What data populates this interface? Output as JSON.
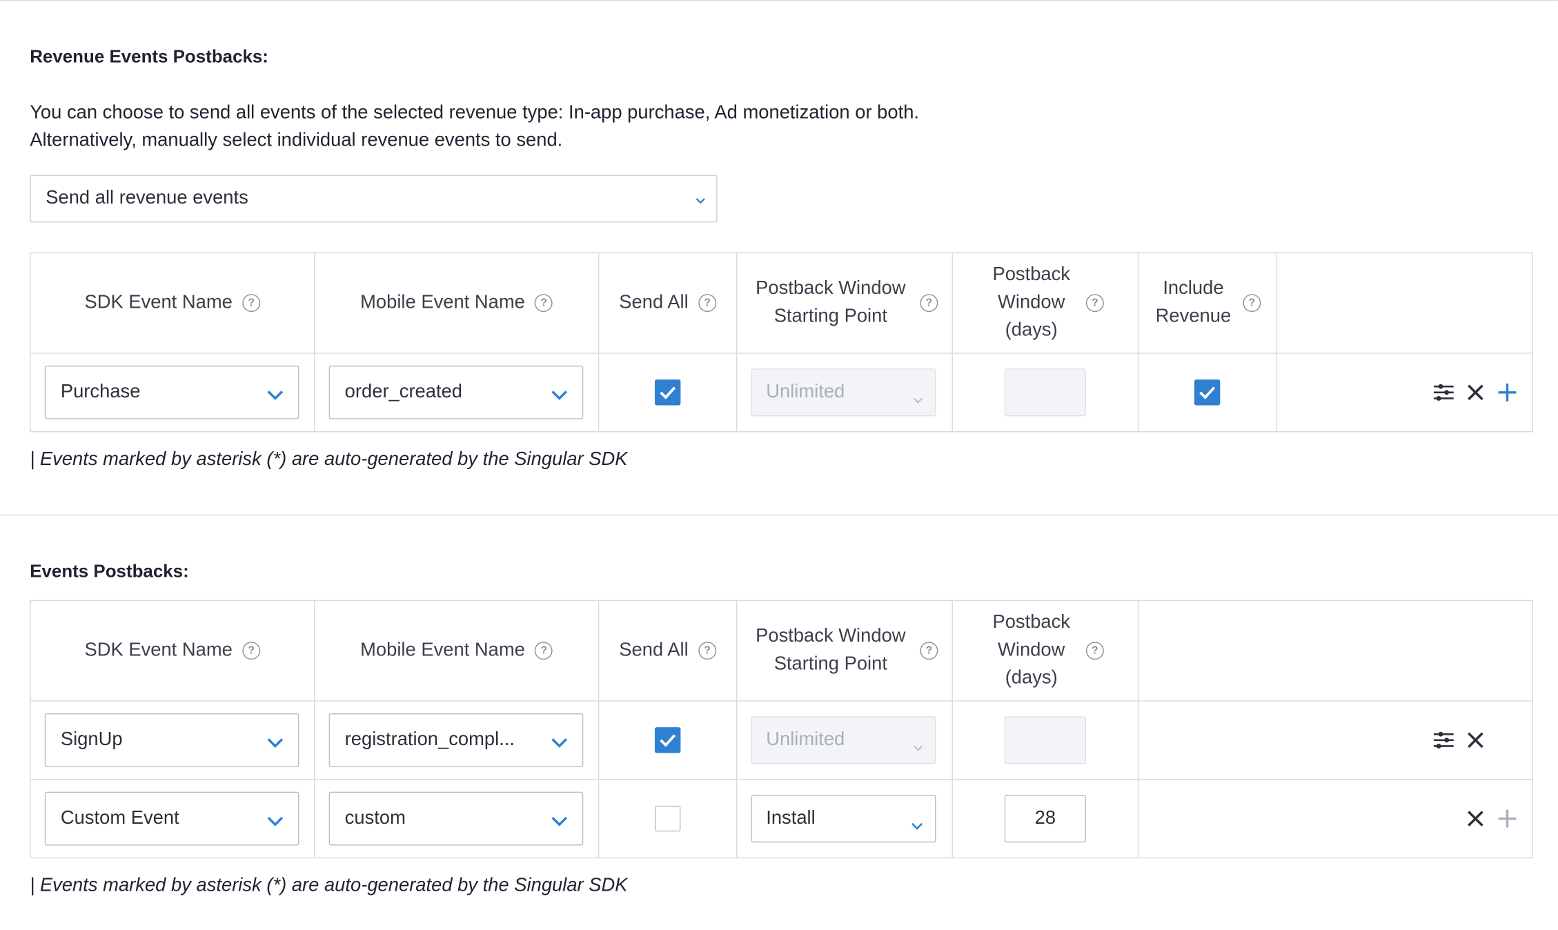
{
  "revenue": {
    "title": "Revenue Events Postbacks:",
    "desc_line1": "You can choose to send all events of the selected revenue type: In-app purchase, Ad monetization or both.",
    "desc_line2": "Alternatively, manually select individual revenue events to send.",
    "select_value": "Send all revenue events",
    "headers": {
      "sdk_event": "SDK Event Name",
      "mobile_event": "Mobile Event Name",
      "send_all": "Send All",
      "window_start": "Postback Window Starting Point",
      "window_days": "Postback Window (days)",
      "include_revenue": "Include Revenue"
    },
    "rows": [
      {
        "sdk_event": "Purchase",
        "mobile_event": "order_created",
        "send_all": true,
        "window_start": "Unlimited",
        "window_days": "",
        "include_revenue": true
      }
    ],
    "note": "| Events marked by asterisk (*) are auto-generated by the Singular SDK"
  },
  "events": {
    "title": "Events Postbacks:",
    "headers": {
      "sdk_event": "SDK Event Name",
      "mobile_event": "Mobile Event Name",
      "send_all": "Send All",
      "window_start": "Postback Window Starting Point",
      "window_days": "Postback Window (days)"
    },
    "rows": [
      {
        "sdk_event": "SignUp",
        "mobile_event": "registration_compl...",
        "send_all": true,
        "window_start": "Unlimited",
        "window_days": ""
      },
      {
        "sdk_event": "Custom Event",
        "mobile_event": "custom",
        "send_all": false,
        "window_start": "Install",
        "window_days": "28"
      }
    ],
    "note": "| Events marked by asterisk (*) are auto-generated by the Singular SDK"
  },
  "colors": {
    "accent": "#2f80d1",
    "border": "#d6dbe3",
    "text": "#2b2f3a",
    "disabled_bg": "#f2f4f7"
  },
  "icons": [
    "help-icon",
    "chevron-down-icon",
    "check-icon",
    "sliders-icon",
    "close-icon",
    "plus-icon"
  ]
}
